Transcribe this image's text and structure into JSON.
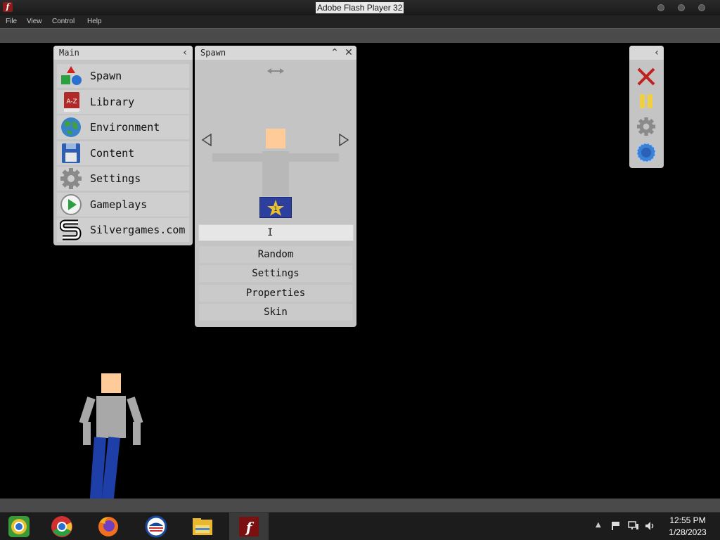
{
  "window": {
    "title": "Adobe Flash Player 32",
    "app_icon_glyph": "f"
  },
  "menu": [
    "File",
    "View",
    "Control",
    "Help"
  ],
  "main_panel": {
    "title": "Main",
    "collapse_icon": "chevron-left-icon",
    "items": [
      {
        "label": "Spawn",
        "icon": "shapes-icon"
      },
      {
        "label": "Library",
        "icon": "book-icon",
        "icon_text": "A-Z"
      },
      {
        "label": "Environment",
        "icon": "globe-icon"
      },
      {
        "label": "Content",
        "icon": "floppy-disk-icon"
      },
      {
        "label": "Settings",
        "icon": "gear-icon"
      },
      {
        "label": "Gameplays",
        "icon": "play-icon"
      },
      {
        "label": "Silvergames.com",
        "icon": "silvergames-logo-icon"
      }
    ]
  },
  "spawn_panel": {
    "title": "Spawn",
    "move_icon": "horizontal-arrows-icon",
    "prev_icon": "triangle-left-icon",
    "next_icon": "triangle-right-icon",
    "badge_number": "1",
    "name_value": "",
    "buttons": [
      "Random",
      "Settings",
      "Properties",
      "Skin"
    ]
  },
  "right_panel": {
    "collapse_icon": "chevron-left-icon",
    "tools": [
      "close-red-x-icon",
      "pause-icon",
      "gear-icon",
      "globe-blue-icon"
    ]
  },
  "taskbar": {
    "apps": [
      "chromium-icon",
      "chrome-icon",
      "firefox-icon",
      "obama-logo-icon",
      "file-explorer-icon",
      "flash-player-icon"
    ],
    "time": "12:55 PM",
    "date": "1/28/2023"
  },
  "colors": {
    "skin": "#ffcc99",
    "shirt": "#a8a8a8",
    "pants": "#1e3fa8",
    "badge_blue": "#2d3f9e",
    "badge_star": "#e8c030",
    "close_red": "#c02020",
    "pause_yellow": "#f0d040"
  }
}
